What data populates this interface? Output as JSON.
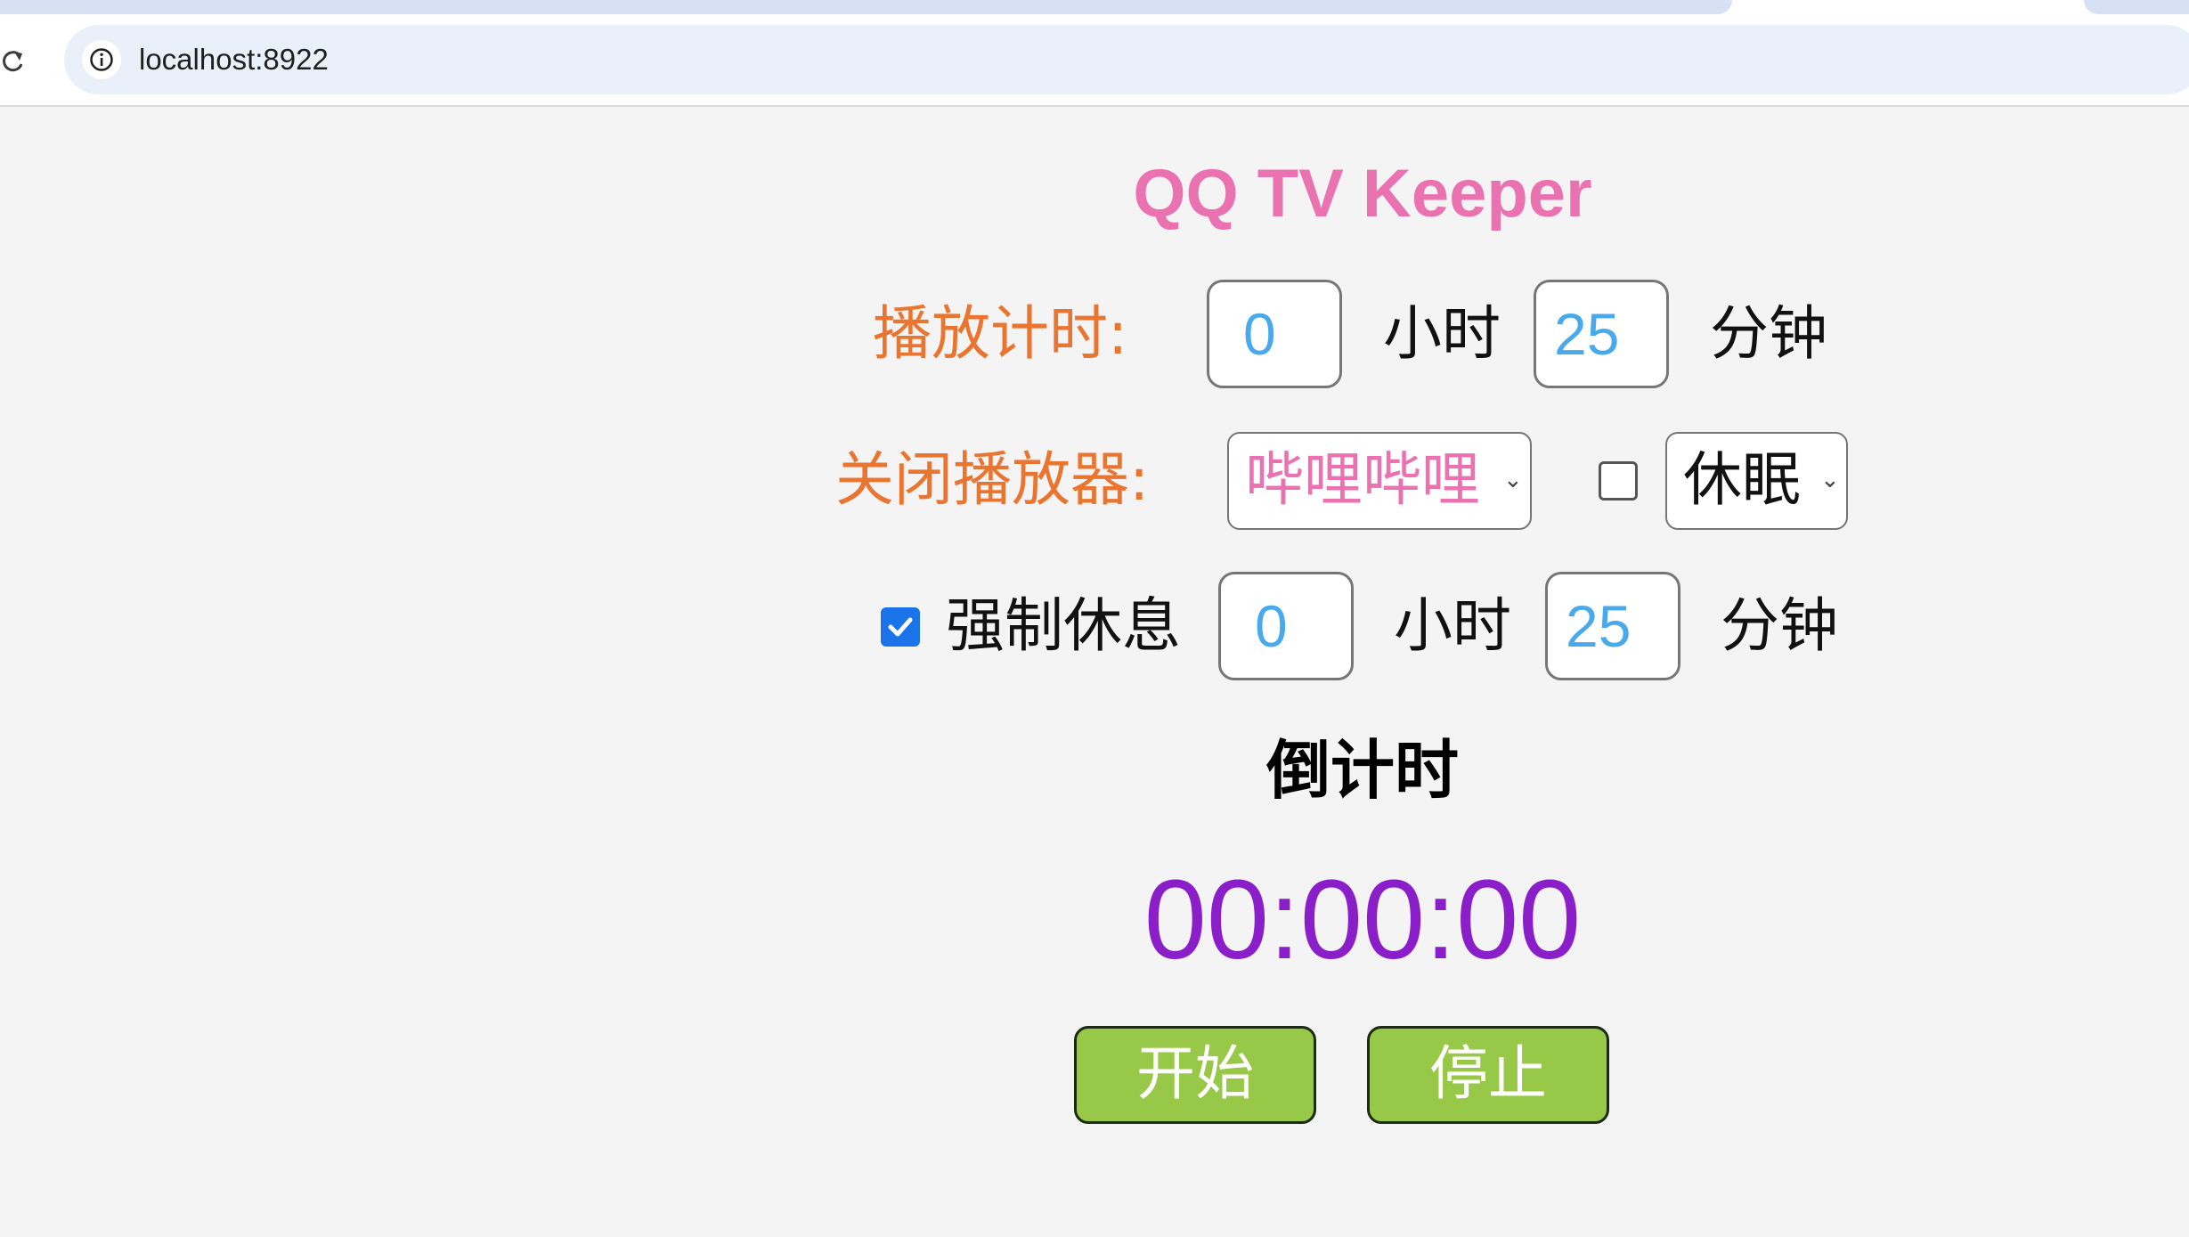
{
  "browser": {
    "url": "localhost:8922"
  },
  "app": {
    "title": "QQ TV Keeper"
  },
  "play_timer": {
    "label": "播放计时:",
    "hours_value": "0",
    "hours_unit": "小时",
    "minutes_value": "25",
    "minutes_unit": "分钟"
  },
  "close_player": {
    "label": "关闭播放器:",
    "player_selected": "哔哩哔哩",
    "sleep_checked": false,
    "power_selected": "休眠"
  },
  "forced_rest": {
    "checked": true,
    "label": "强制休息",
    "hours_value": "0",
    "hours_unit": "小时",
    "minutes_value": "25",
    "minutes_unit": "分钟"
  },
  "countdown": {
    "title": "倒计时",
    "value": "00:00:00"
  },
  "buttons": {
    "start": "开始",
    "stop": "停止"
  },
  "colors": {
    "title": "#ea72b0",
    "label": "#ea7530",
    "input_text": "#49aaeb",
    "countdown": "#8a1ec9",
    "button": "#98c848",
    "checkbox_checked": "#1a73e8"
  },
  "icons": {
    "reload": "reload-icon",
    "site_info": "info-icon",
    "dropdown": "chevron-down-icon",
    "check": "checkmark-icon"
  }
}
